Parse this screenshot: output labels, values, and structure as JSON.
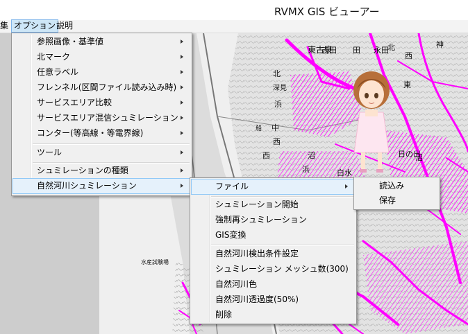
{
  "window": {
    "title": "RVMX GIS ビューアー"
  },
  "menubar": {
    "edit_partial": "集",
    "options": "オプション",
    "help": "説明"
  },
  "map": {
    "labels": [
      "吉田",
      "田",
      "神",
      "東古泉",
      "永田",
      "西",
      "北",
      "浜",
      "深見",
      "中",
      "西",
      "西",
      "津",
      "浜",
      "白水",
      "野",
      "日の出",
      "沼",
      "沼",
      "北",
      "大",
      "東",
      "船",
      "水産試験場"
    ]
  },
  "options_menu": {
    "items": [
      {
        "label": "参照画像・基準値",
        "submenu": true
      },
      {
        "label": "北マーク",
        "submenu": true
      },
      {
        "label": "任意ラベル",
        "submenu": true
      },
      {
        "label": "フレンネル(区間ファイル読み込み時)",
        "submenu": true
      },
      {
        "label": "サービスエリア比較",
        "submenu": true
      },
      {
        "label": "サービスエリア混信シュミレーション",
        "submenu": true
      },
      {
        "label": "コンター(等高線・等電界線)",
        "submenu": true
      },
      {
        "label": "ツール",
        "submenu": true
      },
      {
        "label": "シュミレーションの種類",
        "submenu": true
      },
      {
        "label": "自然河川シュミレーション",
        "submenu": true
      }
    ]
  },
  "river_menu": {
    "items": [
      {
        "label": "ファイル",
        "submenu": true
      },
      {
        "label": "シュミレーション開始"
      },
      {
        "label": "強制再シュミレーション"
      },
      {
        "label": "GIS変換"
      },
      {
        "label": "自然河川検出条件設定"
      },
      {
        "label": "シュミレーション メッシュ数(300)"
      },
      {
        "label": "自然河川色"
      },
      {
        "label": "自然河川透過度(50%)"
      },
      {
        "label": "削除"
      }
    ]
  },
  "file_menu": {
    "items": [
      {
        "label": "読込み"
      },
      {
        "label": "保存"
      }
    ]
  },
  "colors": {
    "river": "#ff00ff",
    "menu_bg": "#f0f0f0",
    "highlight": "#e5f1fb"
  }
}
